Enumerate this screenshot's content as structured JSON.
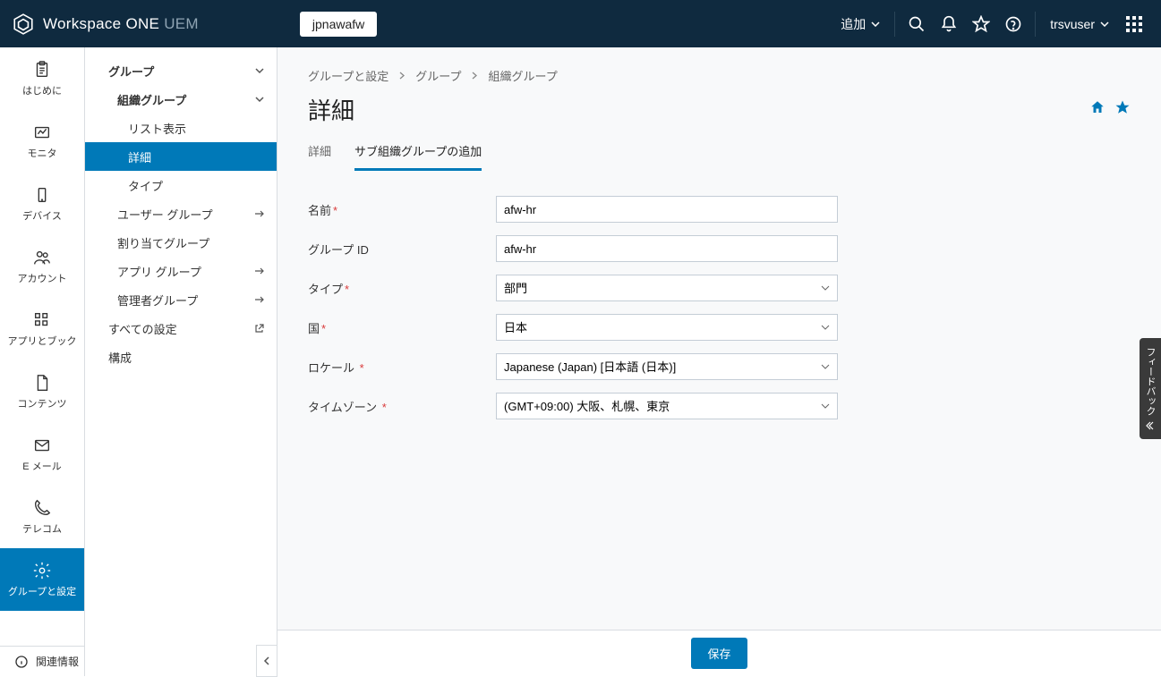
{
  "header": {
    "product_name": "Workspace ONE",
    "product_suffix": "UEM",
    "org_selector": "jpnawafw",
    "add_label": "追加",
    "user_name": "trsvuser"
  },
  "iconbar": {
    "items": [
      {
        "label": "はじめに",
        "icon": "clipboard"
      },
      {
        "label": "モニタ",
        "icon": "monitor"
      },
      {
        "label": "デバイス",
        "icon": "device"
      },
      {
        "label": "アカウント",
        "icon": "accounts"
      },
      {
        "label": "アプリとブック",
        "icon": "apps"
      },
      {
        "label": "コンテンツ",
        "icon": "document"
      },
      {
        "label": "E メール",
        "icon": "email"
      },
      {
        "label": "テレコム",
        "icon": "phone"
      },
      {
        "label": "グループと設定",
        "icon": "gear",
        "active": true
      }
    ],
    "footer": "関連情報"
  },
  "subnav": {
    "group": "グループ",
    "org_group": "組織グループ",
    "list_view": "リスト表示",
    "details": "詳細",
    "type": "タイプ",
    "user_groups": "ユーザー グループ",
    "assignment_groups": "割り当てグループ",
    "app_groups": "アプリ グループ",
    "admin_groups": "管理者グループ",
    "all_settings": "すべての設定",
    "config": "構成"
  },
  "breadcrumb": {
    "crumb1": "グループと設定",
    "crumb2": "グループ",
    "crumb3": "組織グループ"
  },
  "page": {
    "title": "詳細",
    "tab_details": "詳細",
    "tab_add_child": "サブ組織グループの追加"
  },
  "form": {
    "name_label": "名前",
    "name_value": "afw-hr",
    "gid_label": "グループ ID",
    "gid_value": "afw-hr",
    "type_label": "タイプ",
    "type_value": "部門",
    "country_label": "国",
    "country_value": "日本",
    "locale_label": "ロケール",
    "locale_value": "Japanese (Japan) [日本語 (日本)]",
    "tz_label": "タイムゾーン",
    "tz_value": "(GMT+09:00) 大阪、札幌、東京"
  },
  "actions": {
    "save": "保存"
  },
  "feedback": "フィードバック"
}
